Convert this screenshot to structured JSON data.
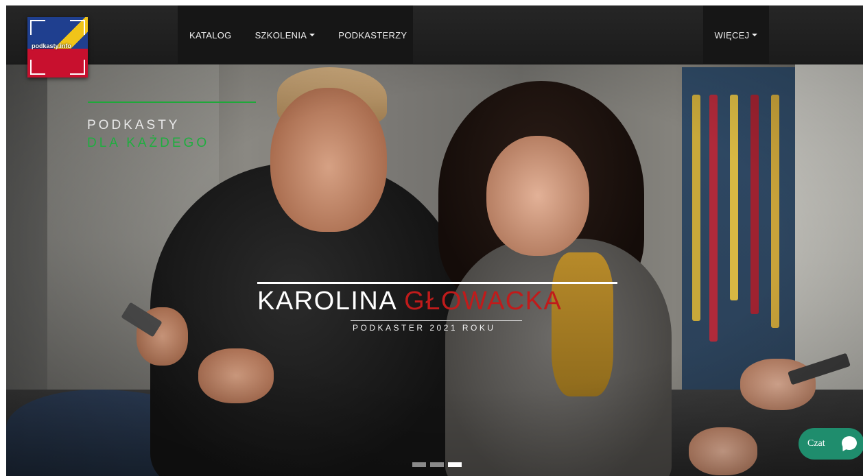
{
  "navbar": {
    "logo_text": "podkasty.info",
    "items": [
      {
        "label": "KATALOG"
      },
      {
        "label": "SZKOLENIA"
      },
      {
        "label": "PODKASTERZY"
      }
    ],
    "more_label": "WIĘCEJ"
  },
  "hero": {
    "tagline_line1": "PODKASTY",
    "tagline_line2": "DLA KAŻDEGO",
    "title_first": "KAROLINA",
    "title_last": "GŁOWACKA",
    "subtitle": "PODKASTER 2021 ROKU",
    "slides_total": 3,
    "active_slide": 3
  },
  "chat": {
    "label": "Czat"
  },
  "colors": {
    "accent_green": "#1fae3f",
    "accent_red": "#c01b1b",
    "chat_green": "#1f8d6d"
  },
  "icons": [
    "chat-bubble-icon",
    "caret-down-icon"
  ]
}
